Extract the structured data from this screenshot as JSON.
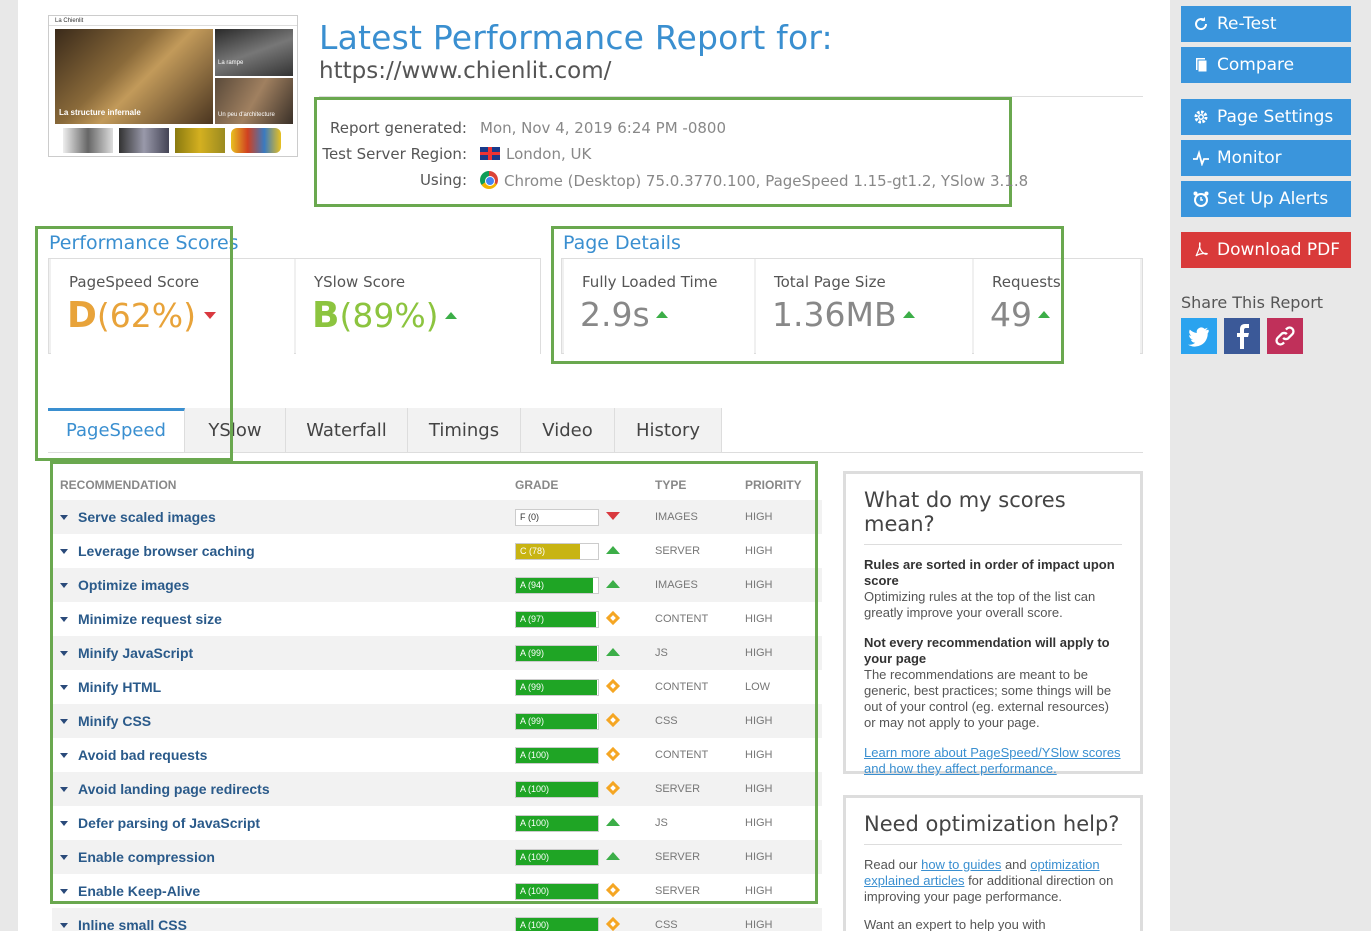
{
  "header": {
    "title": "Latest Performance Report for:",
    "url": "https://www.chienlit.com/"
  },
  "thumbnail": {
    "site_name": "La Chienlit",
    "hero_caption": "La structure infernale",
    "side_caption_1": "La rampe",
    "side_caption_2": "Un peu d'architecture"
  },
  "meta": {
    "generated_label": "Report generated:",
    "generated_value": "Mon, Nov 4, 2019 6:24 PM -0800",
    "region_label": "Test Server Region:",
    "region_value": "London, UK",
    "using_label": "Using:",
    "using_value": "Chrome (Desktop) 75.0.3770.100, PageSpeed 1.15-gt1.2, YSlow 3.1.8"
  },
  "scores": {
    "title": "Performance Scores",
    "pagespeed": {
      "label": "PageSpeed Score",
      "grade": "D",
      "value": "(62%)",
      "color": "#e8a33a",
      "trend": "down"
    },
    "yslow": {
      "label": "YSlow Score",
      "grade": "B",
      "value": "(89%)",
      "color": "#8cc43f",
      "trend": "up"
    }
  },
  "details": {
    "title": "Page Details",
    "items": [
      {
        "label": "Fully Loaded Time",
        "value": "2.9s",
        "trend": "up"
      },
      {
        "label": "Total Page Size",
        "value": "1.36MB",
        "trend": "up"
      },
      {
        "label": "Requests",
        "value": "49",
        "trend": "up"
      }
    ]
  },
  "tabs": [
    "PageSpeed",
    "YSlow",
    "Waterfall",
    "Timings",
    "Video",
    "History"
  ],
  "table": {
    "headers": {
      "recommendation": "RECOMMENDATION",
      "grade": "GRADE",
      "type": "TYPE",
      "priority": "PRIORITY"
    },
    "rows": [
      {
        "name": "Serve scaled images",
        "grade": "F (0)",
        "score": 0,
        "color": "#ffffff",
        "indicator": "down",
        "type": "IMAGES",
        "priority": "HIGH"
      },
      {
        "name": "Leverage browser caching",
        "grade": "C (78)",
        "score": 78,
        "color": "#c8b413",
        "indicator": "up",
        "type": "SERVER",
        "priority": "HIGH"
      },
      {
        "name": "Optimize images",
        "grade": "A (94)",
        "score": 94,
        "color": "#1fa525",
        "indicator": "up",
        "type": "IMAGES",
        "priority": "HIGH"
      },
      {
        "name": "Minimize request size",
        "grade": "A (97)",
        "score": 97,
        "color": "#1fa525",
        "indicator": "diamond",
        "type": "CONTENT",
        "priority": "HIGH"
      },
      {
        "name": "Minify JavaScript",
        "grade": "A (99)",
        "score": 99,
        "color": "#1fa525",
        "indicator": "up",
        "type": "JS",
        "priority": "HIGH"
      },
      {
        "name": "Minify HTML",
        "grade": "A (99)",
        "score": 99,
        "color": "#1fa525",
        "indicator": "diamond",
        "type": "CONTENT",
        "priority": "LOW"
      },
      {
        "name": "Minify CSS",
        "grade": "A (99)",
        "score": 99,
        "color": "#1fa525",
        "indicator": "diamond",
        "type": "CSS",
        "priority": "HIGH"
      },
      {
        "name": "Avoid bad requests",
        "grade": "A (100)",
        "score": 100,
        "color": "#1fa525",
        "indicator": "diamond",
        "type": "CONTENT",
        "priority": "HIGH"
      },
      {
        "name": "Avoid landing page redirects",
        "grade": "A (100)",
        "score": 100,
        "color": "#1fa525",
        "indicator": "diamond",
        "type": "SERVER",
        "priority": "HIGH"
      },
      {
        "name": "Defer parsing of JavaScript",
        "grade": "A (100)",
        "score": 100,
        "color": "#1fa525",
        "indicator": "up",
        "type": "JS",
        "priority": "HIGH"
      },
      {
        "name": "Enable compression",
        "grade": "A (100)",
        "score": 100,
        "color": "#1fa525",
        "indicator": "up",
        "type": "SERVER",
        "priority": "HIGH"
      },
      {
        "name": "Enable Keep-Alive",
        "grade": "A (100)",
        "score": 100,
        "color": "#1fa525",
        "indicator": "diamond",
        "type": "SERVER",
        "priority": "HIGH"
      },
      {
        "name": "Inline small CSS",
        "grade": "A (100)",
        "score": 100,
        "color": "#1fa525",
        "indicator": "diamond",
        "type": "CSS",
        "priority": "HIGH"
      }
    ]
  },
  "info1": {
    "title": "What do my scores mean?",
    "b1": "Rules are sorted in order of impact upon score",
    "p1": "Optimizing rules at the top of the list can greatly improve your overall score.",
    "b2": "Not every recommendation will apply to your page",
    "p2": "The recommendations are meant to be generic, best practices; some things will be out of your control (eg. external resources) or may not apply to your page.",
    "link": "Learn more about PageSpeed/YSlow scores and how they affect performance."
  },
  "info2": {
    "title": "Need optimization help?",
    "p1_pre": "Read our ",
    "link1": "how to guides",
    "p1_mid": " and ",
    "link2": "optimization explained articles",
    "p1_post": " for additional direction on improving your page performance.",
    "p2": "Want an expert to help you with"
  },
  "sidebar": {
    "retest": "Re-Test",
    "compare": "Compare",
    "settings": "Page Settings",
    "monitor": "Monitor",
    "alerts": "Set Up Alerts",
    "pdf": "Download PDF",
    "share_title": "Share This Report"
  }
}
